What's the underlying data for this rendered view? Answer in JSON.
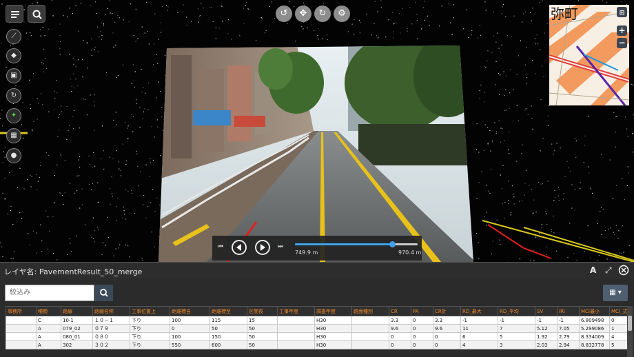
{
  "viewport": {
    "top_toolbar": [
      "rotate-icon",
      "pan-icon",
      "orbit-icon",
      "settings-icon"
    ],
    "left_toolbar": [
      "measure-icon",
      "tag-icon",
      "layers-icon",
      "refresh-icon",
      "points-icon",
      "qr-icon",
      "objects-icon"
    ]
  },
  "minimap": {
    "label": "弥町",
    "zoom_in": "+",
    "zoom_out": "−"
  },
  "player": {
    "start_distance": "749.9 m",
    "end_distance": "970.4 m",
    "progress": 0.79
  },
  "layer_panel": {
    "title": "レイヤ名: PavementResult_50_merge",
    "font_icon": "A"
  },
  "search": {
    "placeholder": "絞込み"
  },
  "table": {
    "columns": [
      "事務所",
      "種類",
      "路線",
      "路線名称",
      "工事位置上",
      "距離標自",
      "距離標至",
      "区間長",
      "工事年度",
      "調査年度",
      "路面種別",
      "CR",
      "PA",
      "CR計",
      "RD_最大",
      "RD_平均",
      "SV",
      "IRI",
      "MCI最小",
      "MCI_式"
    ],
    "rows": [
      [
        "",
        "C",
        "10-1",
        "１０－１",
        "下り",
        "100",
        "115",
        "15",
        "",
        "H30",
        "",
        "3.3",
        "0",
        "3.3",
        "-1",
        "-1",
        "-1",
        "-1",
        "6.809498",
        "0"
      ],
      [
        "",
        "A",
        "079_02",
        "０７９",
        "下り",
        "0",
        "50",
        "50",
        "",
        "H30",
        "",
        "9.6",
        "0",
        "9.6",
        "11",
        "7",
        "5.12",
        "7.05",
        "5.299086",
        "1"
      ],
      [
        "",
        "A",
        "080_01",
        "０８０",
        "下り",
        "100",
        "150",
        "50",
        "",
        "H30",
        "",
        "0",
        "0",
        "0",
        "6",
        "5",
        "1.92",
        "2.79",
        "8.334009",
        "4"
      ],
      [
        "",
        "A",
        "302",
        "３０２",
        "下り",
        "550",
        "600",
        "50",
        "",
        "H30",
        "",
        "0",
        "0",
        "0",
        "4",
        "3",
        "2.03",
        "2.94",
        "8.832778",
        "5"
      ]
    ]
  },
  "colors": {
    "header_text": "#f08b2a",
    "accent_blue": "#3fa0e8",
    "lane_yellow": "#e8c21a"
  }
}
